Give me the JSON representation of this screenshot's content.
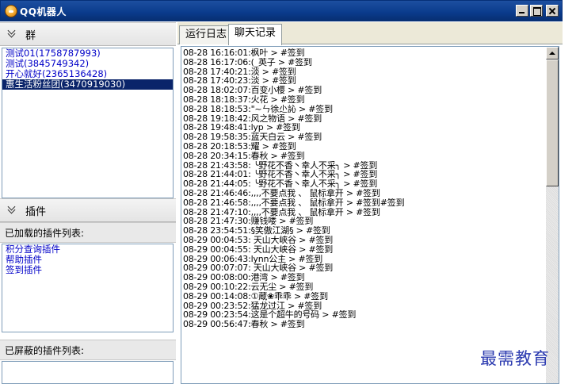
{
  "window": {
    "title": "QQ机器人"
  },
  "left": {
    "groups_header": "群",
    "groups": [
      {
        "label": "测试01(1758787993)",
        "selected": false
      },
      {
        "label": "测试(3845749342)",
        "selected": false
      },
      {
        "label": "开心就好(2365136428)",
        "selected": false
      },
      {
        "label": "惠生活粉丝团(3470919030)",
        "selected": true
      }
    ],
    "plugins_header": "插件",
    "loaded_label": "已加载的插件列表:",
    "loaded_plugins": [
      "积分查询插件",
      "帮助插件",
      "签到插件"
    ],
    "blocked_label": "已屏蔽的插件列表:"
  },
  "tabs": [
    {
      "label": "运行日志",
      "active": false
    },
    {
      "label": "聊天记录",
      "active": true
    }
  ],
  "chat_lines": [
    "08-28 16:16:01:枫叶 > #签到",
    "08-28 16:17:06:(_英子 > #签到",
    "08-28 17:40:21:淡 > #签到",
    "08-28 17:40:23:淡 > #签到",
    "08-28 18:02:07:百变小樱 > #签到",
    "08-28 18:18:37:火花 > #签到",
    "08-28 18:18:53:\"~ㄣ徐尐訫 > #签到",
    "08-28 19:18:42:风之物语 > #签到",
    "08-28 19:48:41:lyp > #签到",
    "08-28 19:58:35:蓝天白云 > #签到",
    "08-28 20:18:53:耀 > #签到",
    "08-28 20:34:15:春秋 > #签到",
    "08-28 21:43:58: ╰野花不香丶幸人不采╮ > #签到",
    "08-28 21:44:01: ╰野花不香丶幸人不采╮ > #签到",
    "08-28 21:44:05: ╰野花不香丶幸人不采╮ > #签到",
    "08-28 21:46:46:,,,,不要点我 、 鼠标拿开 > #签到",
    "08-28 21:46:58:,,,,不要点我 、 鼠标拿开 > #签到#签到",
    "08-28 21:47:10:,,,,不要点我 、 鼠标拿开 > #签到",
    "08-28 21:47:30:赚钱喽 > #签到",
    "08-28 23:54:51:§笑傲江湖§ > #签到",
    "08-29 00:04:53: 天山大峡谷 > #签到",
    "08-29 00:04:55: 天山大峡谷 > #签到",
    "08-29 00:06:43:lynn公主 > #签到",
    "08-29 00:07:07: 天山大峡谷 > #签到",
    "08-29 00:08:00:港湾 > #签到",
    "08-29 00:10:22:云无尘 > #签到",
    "08-29 00:14:08:①蔵❀乖乖 > #签到",
    "08-29 00:23:52:猛龙过江 > #签到",
    "08-29 00:23:54:这是个超牛的号码 > #签到",
    "08-29 00:56:47:春秋 > #签到"
  ],
  "watermark": "最需教育"
}
